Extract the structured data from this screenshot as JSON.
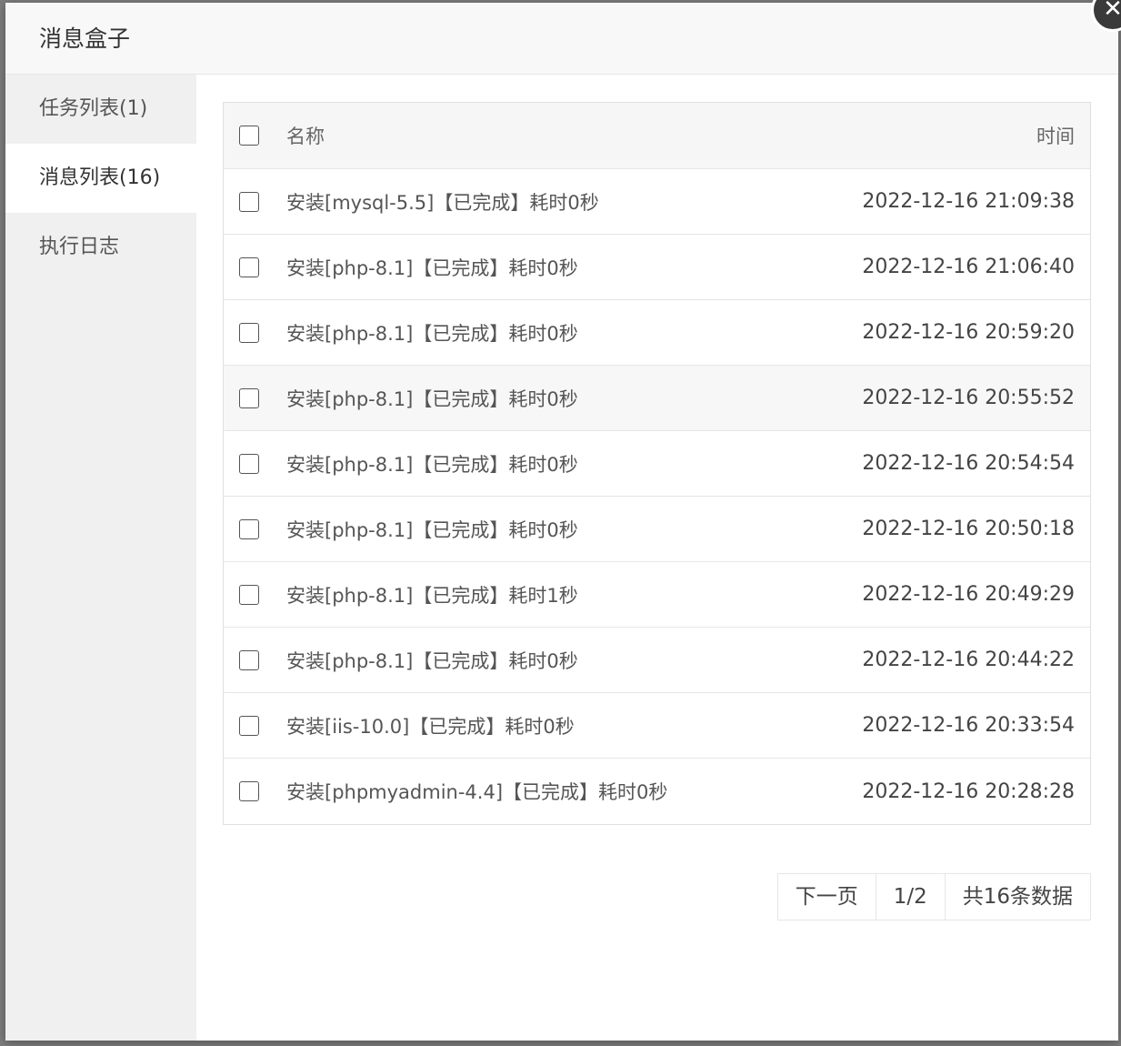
{
  "dialog": {
    "title": "消息盒子",
    "close_glyph": "✕"
  },
  "sidebar": {
    "items": [
      {
        "label": "任务列表(1)",
        "active": false
      },
      {
        "label": "消息列表(16)",
        "active": true
      },
      {
        "label": "执行日志",
        "active": false
      }
    ]
  },
  "table": {
    "headers": {
      "name": "名称",
      "time": "时间"
    },
    "rows": [
      {
        "name": "安装[mysql-5.5]【已完成】耗时0秒",
        "time": "2022-12-16 21:09:38"
      },
      {
        "name": "安装[php-8.1]【已完成】耗时0秒",
        "time": "2022-12-16 21:06:40"
      },
      {
        "name": "安装[php-8.1]【已完成】耗时0秒",
        "time": "2022-12-16 20:59:20"
      },
      {
        "name": "安装[php-8.1]【已完成】耗时0秒",
        "time": "2022-12-16 20:55:52"
      },
      {
        "name": "安装[php-8.1]【已完成】耗时0秒",
        "time": "2022-12-16 20:54:54"
      },
      {
        "name": "安装[php-8.1]【已完成】耗时0秒",
        "time": "2022-12-16 20:50:18"
      },
      {
        "name": "安装[php-8.1]【已完成】耗时1秒",
        "time": "2022-12-16 20:49:29"
      },
      {
        "name": "安装[php-8.1]【已完成】耗时0秒",
        "time": "2022-12-16 20:44:22"
      },
      {
        "name": "安装[iis-10.0]【已完成】耗时0秒",
        "time": "2022-12-16 20:33:54"
      },
      {
        "name": "安装[phpmyadmin-4.4]【已完成】耗时0秒",
        "time": "2022-12-16 20:28:28"
      }
    ]
  },
  "pager": {
    "next_label": "下一页",
    "page_indicator": "1/2",
    "total_label": "共16条数据"
  }
}
